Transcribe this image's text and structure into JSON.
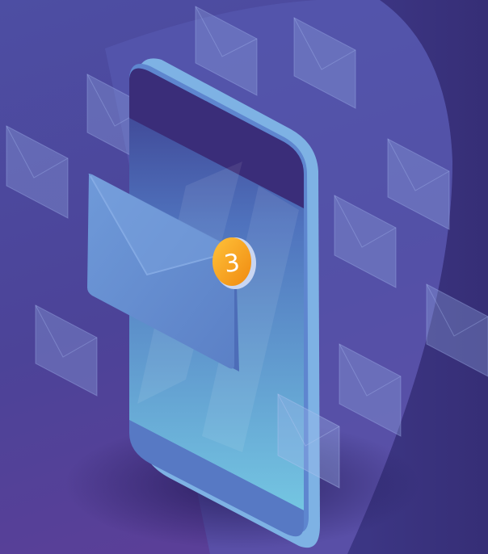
{
  "illustration": {
    "notification_count": "3",
    "colors": {
      "background_top": "#4e4c9f",
      "background_bottom": "#4a3a8e",
      "spotlight": "#5a5fb3",
      "phone_body": "#5f8ed0",
      "phone_edge": "#7fb0e2",
      "screen_top": "#3a2f78",
      "screen_bottom": "#6cc2e0",
      "envelope": "#6b93d4",
      "badge": "#f6a81c"
    }
  }
}
